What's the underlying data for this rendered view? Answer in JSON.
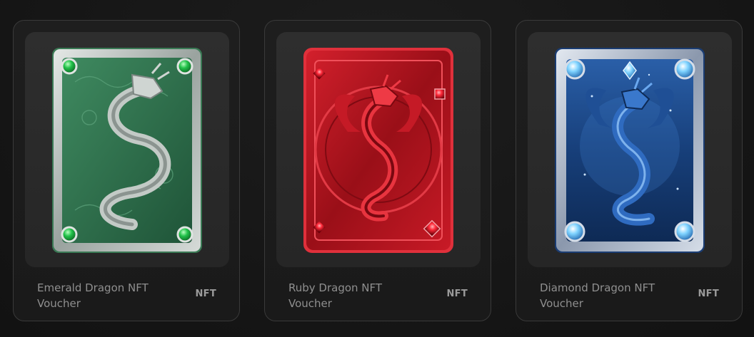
{
  "cards": [
    {
      "title": "Emerald Dragon NFT Voucher",
      "badge": "NFT",
      "theme": {
        "base": "#2f6b4a",
        "frame": "#b9bfbd",
        "gem": "#22c24a",
        "dragon": "#a9b0ad"
      },
      "icon": "emerald-dragon-card-art"
    },
    {
      "title": "Ruby Dragon NFT Voucher",
      "badge": "NFT",
      "theme": {
        "base": "#a0121c",
        "frame": "#d7222d",
        "gem": "#ff2a3a",
        "dragon": "#e02634"
      },
      "icon": "ruby-dragon-card-art"
    },
    {
      "title": "Diamond Dragon NFT Voucher",
      "badge": "NFT",
      "theme": {
        "base": "#173f7a",
        "frame": "#aebbd0",
        "gem": "#7fd3ff",
        "dragon": "#2c63b5"
      },
      "icon": "diamond-dragon-card-art"
    }
  ]
}
